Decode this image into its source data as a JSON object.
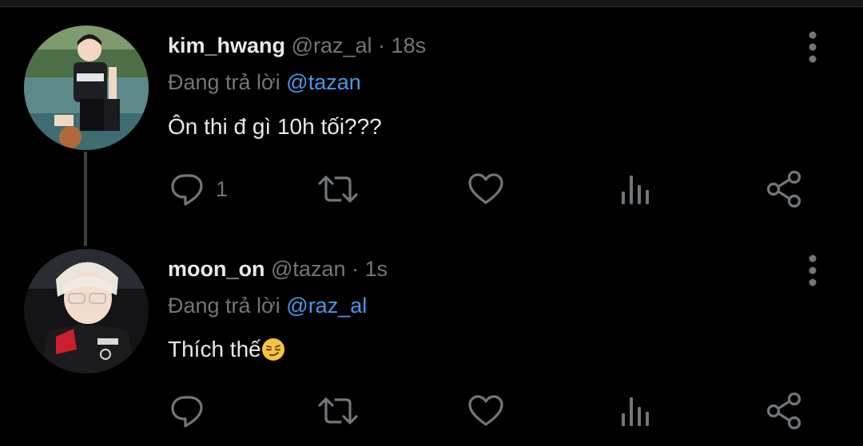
{
  "tweets": [
    {
      "display_name": "kim_hwang",
      "handle": "@raz_al",
      "separator": "·",
      "time": "18s",
      "reply_prefix": "Đang trả lời",
      "reply_to": "@tazan",
      "text": "Ôn thi đ gì 10h tối???",
      "reply_count": "1"
    },
    {
      "display_name": "moon_on",
      "handle": "@tazan",
      "separator": "·",
      "time": "1s",
      "reply_prefix": "Đang trả lời",
      "reply_to": "@raz_al",
      "text": "Thích thế",
      "emoji": "smirking-face",
      "reply_count": ""
    }
  ],
  "colors": {
    "background": "#000000",
    "text_primary": "#e7e9ea",
    "text_secondary": "#71767b",
    "mention": "#4a99e9",
    "thread_line": "#3e4144"
  },
  "icons": [
    "reply-icon",
    "retweet-icon",
    "like-icon",
    "views-icon",
    "share-icon",
    "more-options-icon"
  ]
}
